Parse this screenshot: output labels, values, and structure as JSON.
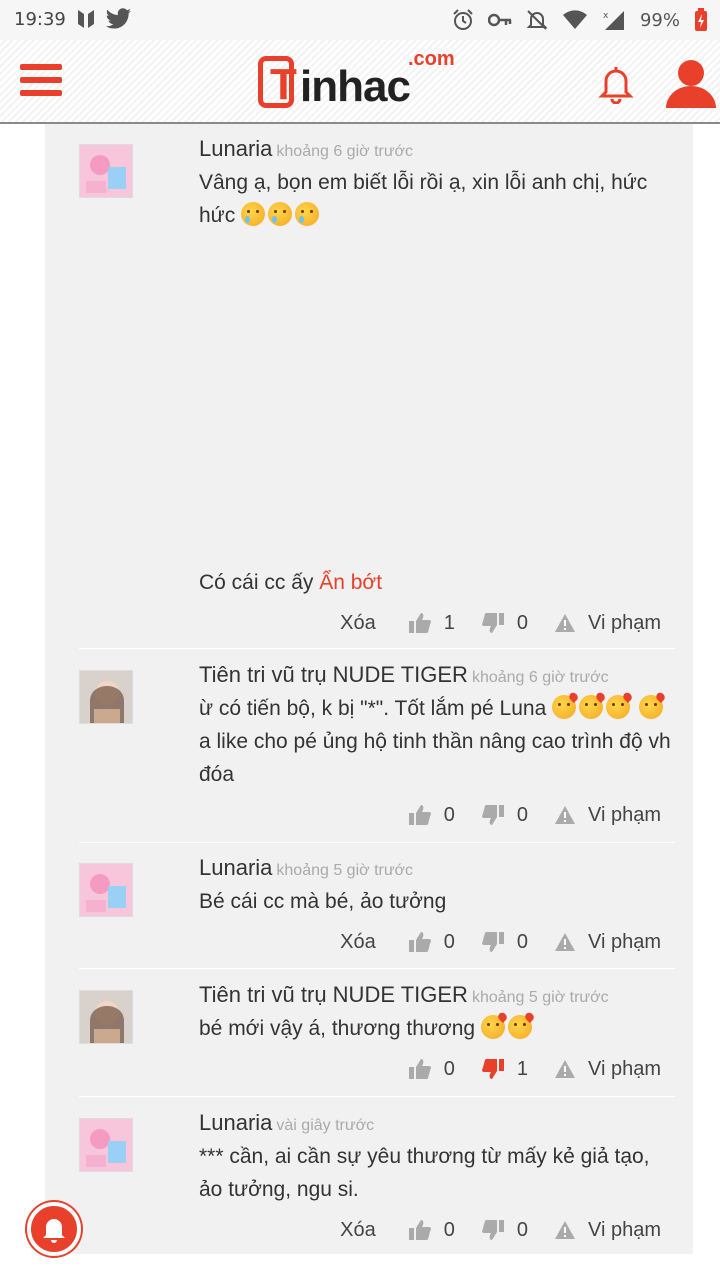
{
  "status_bar": {
    "time": "19:39",
    "battery": "99%"
  },
  "header": {
    "logo_main": "inhac",
    "logo_t": "T",
    "logo_com": ".com"
  },
  "comments": [
    {
      "author": "Lunaria",
      "time": "khoảng 6 giờ trước",
      "text": "Vâng ạ, bọn em biết lỗi rồi ạ, xin lỗi anh chị, hức hức",
      "extra_text": "Có cái cc ấy",
      "extra_link": "Ẩn bớt",
      "delete_label": "Xóa",
      "likes": "1",
      "dislikes": "0",
      "report_label": "Vi phạm"
    },
    {
      "author": "Tiên tri vũ trụ NUDE TIGER",
      "time": "khoảng 6 giờ trước",
      "text": "ừ có tiến bộ, k bị \"*\". Tốt lắm pé Luna",
      "text2": "a like cho pé ủng hộ tinh thần nâng cao trình độ vh đóa",
      "likes": "0",
      "dislikes": "0",
      "report_label": "Vi phạm"
    },
    {
      "author": "Lunaria",
      "time": "khoảng 5 giờ trước",
      "text": "Bé cái cc mà bé, ảo tưởng",
      "delete_label": "Xóa",
      "likes": "0",
      "dislikes": "0",
      "report_label": "Vi phạm"
    },
    {
      "author": "Tiên tri vũ trụ NUDE TIGER",
      "time": "khoảng 5 giờ trước",
      "text": "bé mới vậy á, thương thương",
      "likes": "0",
      "dislikes": "1",
      "report_label": "Vi phạm"
    },
    {
      "author": "Lunaria",
      "time": "vài giây trước",
      "text": "*** cần, ai cần sự yêu thương từ mấy kẻ giả tạo, ảo tưởng, ngu si.",
      "delete_label": "Xóa",
      "likes": "0",
      "dislikes": "0",
      "report_label": "Vi phạm"
    }
  ],
  "colors": {
    "accent": "#e8402a",
    "panel": "#f1f1f1"
  }
}
